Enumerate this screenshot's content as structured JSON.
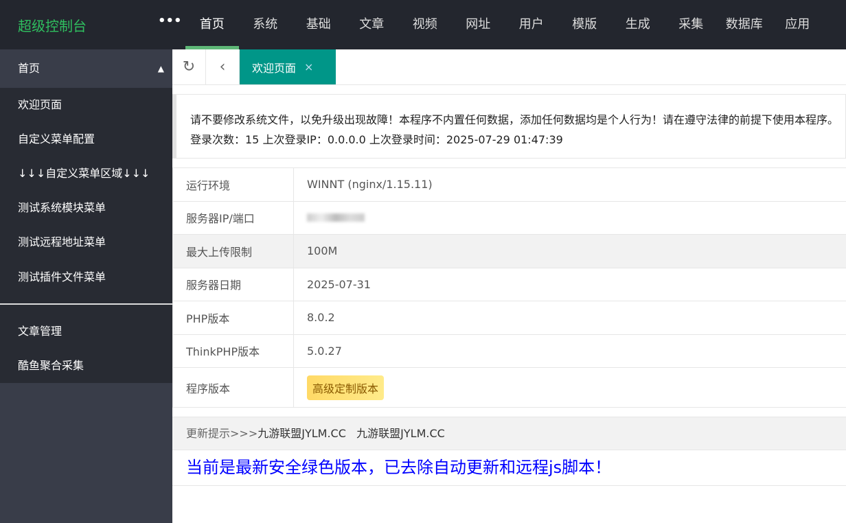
{
  "header": {
    "logo": "超级控制台",
    "more": "•••",
    "nav": [
      "首页",
      "系统",
      "基础",
      "文章",
      "视频",
      "网址",
      "用户",
      "模版",
      "生成",
      "采集",
      "数据库",
      "应用"
    ]
  },
  "sidebar": {
    "head": "首页",
    "group1": [
      "欢迎页面",
      "自定义菜单配置",
      "↓↓↓自定义菜单区域↓↓↓",
      "测试系统模块菜单",
      "测试远程地址菜单",
      "测试插件文件菜单"
    ],
    "group2": [
      "文章管理",
      "酷鱼聚合采集"
    ]
  },
  "tabs": {
    "active": "欢迎页面"
  },
  "notice": {
    "line1": "请不要修改系统文件，以免升级出现故障！本程序不内置任何数据，添加任何数据均是个人行为！请在遵守法律的前提下使用本程序。",
    "line2": "登录次数：15 上次登录IP：0.0.0.0 上次登录时间：2025-07-29 01:47:39"
  },
  "info": [
    {
      "label": "运行环境",
      "value": "WINNT (nginx/1.15.11)"
    },
    {
      "label": "服务器IP/端口",
      "value": null
    },
    {
      "label": "最大上传限制",
      "value": "100M"
    },
    {
      "label": "服务器日期",
      "value": "2025-07-31"
    },
    {
      "label": "PHP版本",
      "value": "8.0.2"
    },
    {
      "label": "ThinkPHP版本",
      "value": "5.0.27"
    },
    {
      "label": "程序版本",
      "value": "高级定制版本"
    }
  ],
  "update": {
    "prefix": "更新提示>>>",
    "links": [
      "九游联盟JYLM.CC",
      "九游联盟JYLM.CC"
    ],
    "message": "当前是最新安全绿色版本，已去除自动更新和远程js脚本！"
  }
}
